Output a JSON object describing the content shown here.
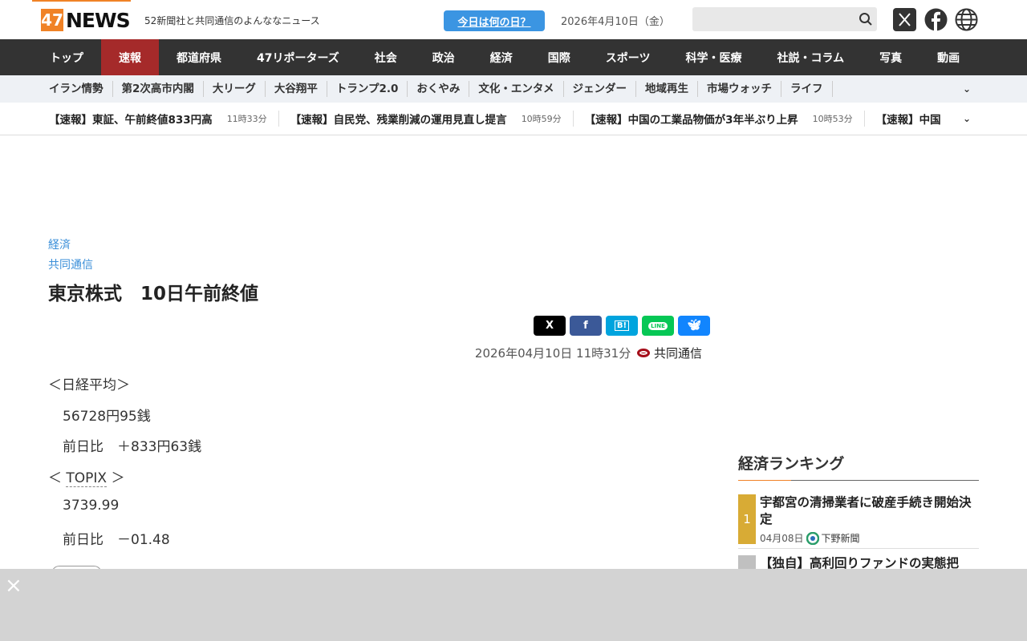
{
  "header": {
    "logo_num": "47",
    "logo_text": "NEWS",
    "tagline": "52新聞社と共同通信のよんななニュース",
    "today_button": "今日は何の日？",
    "date": "2026年4月10日（金）",
    "search_placeholder": ""
  },
  "nav": [
    "トップ",
    "速報",
    "都道府県",
    "47リポーターズ",
    "社会",
    "政治",
    "経済",
    "国際",
    "スポーツ",
    "科学・医療",
    "社説・コラム",
    "写真",
    "動画"
  ],
  "subnav": [
    "イラン情勢",
    "第2次高市内閣",
    "大リーグ",
    "大谷翔平",
    "トランプ2.0",
    "おくやみ",
    "文化・エンタメ",
    "ジェンダー",
    "地域再生",
    "市場ウォッチ",
    "ライフ"
  ],
  "breaking": [
    {
      "title": "【速報】東証、午前終値833円高",
      "time": "11時33分"
    },
    {
      "title": "【速報】自民党、残業削減の運用見直し提言",
      "time": "10時59分"
    },
    {
      "title": "【速報】中国の工業品物価が3年半ぶり上昇",
      "time": "10時53分"
    },
    {
      "title": "【速報】中国",
      "time": ""
    }
  ],
  "article": {
    "category": "経済",
    "source": "共同通信",
    "title": "東京株式　10日午前終値",
    "published": "2026年04月10日 11時31分",
    "agency": "共同通信",
    "lines": [
      "＜日経平均＞",
      "56728円95銭",
      "前日比　＋833円63銭",
      "＜",
      "TOPIX",
      "＞",
      "3739.99",
      "前日比　－01.48"
    ]
  },
  "share": [
    "X",
    "f",
    "B!",
    "LINE",
    "bluesky"
  ],
  "ranking": {
    "title": "経済ランキング",
    "items": [
      {
        "rank": "1",
        "title": "宇都宮の清掃業者に破産手続き開始決定",
        "date": "04月08日",
        "source": "下野新聞",
        "color": "#d8ab35"
      },
      {
        "rank": "",
        "title": "【独自】高利回りファンドの実態把",
        "date": "",
        "source": "",
        "color": "#c0c0c0"
      }
    ]
  },
  "overlay": {
    "close": "×"
  }
}
